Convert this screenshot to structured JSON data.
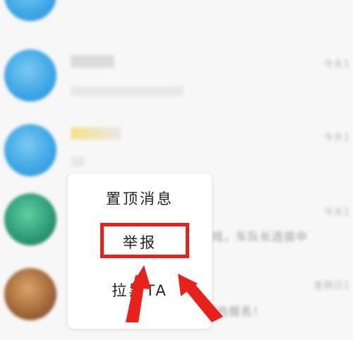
{
  "chat_list": {
    "rows": [
      {
        "time": "",
        "avatar": "blue"
      },
      {
        "time": "今天1",
        "avatar": "blue"
      },
      {
        "time": "今天1",
        "avatar": "blue"
      },
      {
        "time": "今天1",
        "avatar": "green",
        "message_tail": "戏，车队长选拔中"
      },
      {
        "time": "星期日1",
        "avatar": "brown",
        "message_tail": "开启报名！"
      }
    ]
  },
  "context_menu": {
    "items": [
      {
        "label": "置顶消息"
      },
      {
        "label": "举报"
      },
      {
        "label": "拉黑TA"
      }
    ],
    "highlighted_index": 1
  },
  "annotation": {
    "color": "#e8221b"
  }
}
